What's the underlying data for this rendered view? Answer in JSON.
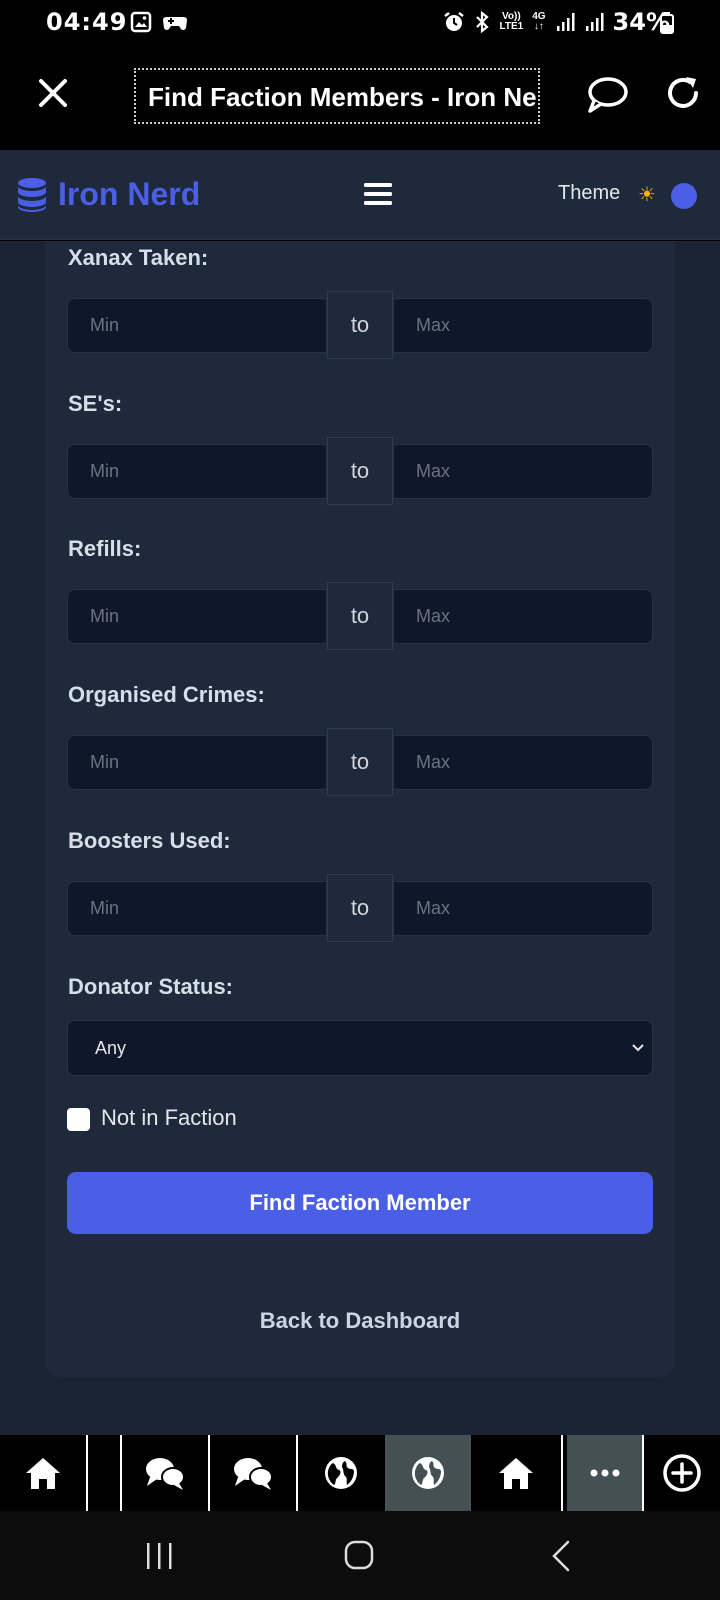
{
  "status_bar": {
    "time": "04:49",
    "network_top": "Vo))",
    "network_bottom": "LTE1",
    "network_type": "4G",
    "battery": "34%",
    "left_icons": [
      "image-icon",
      "game-controller-icon"
    ],
    "right_icons": [
      "alarm-icon",
      "bluetooth-icon",
      "signal-icon",
      "signal-icon",
      "battery-icon"
    ]
  },
  "browser": {
    "title": "Find Faction Members - Iron Nerd",
    "close_icon": "close-icon",
    "chat_icon": "chat-bubble-icon",
    "refresh_icon": "refresh-icon"
  },
  "header": {
    "brand": "Iron Nerd",
    "brand_icon": "database-icon",
    "menu_icon": "hamburger-icon",
    "theme_label": "Theme",
    "theme_icon": "sun-icon",
    "accent_color": "#4b5fe6"
  },
  "form": {
    "range_separator": "to",
    "min_placeholder": "Min",
    "max_placeholder": "Max",
    "fields": [
      {
        "label": "Xanax Taken:"
      },
      {
        "label": "SE's:"
      },
      {
        "label": "Refills:"
      },
      {
        "label": "Organised Crimes:"
      },
      {
        "label": "Boosters Used:"
      }
    ],
    "donator_status": {
      "label": "Donator Status:",
      "selected": "Any"
    },
    "not_in_faction": {
      "label": "Not in Faction",
      "checked": false
    },
    "submit_label": "Find Faction Member",
    "back_link": "Back to Dashboard"
  },
  "tab_bar": {
    "tabs": [
      {
        "icon": "home-icon",
        "active": false
      },
      {
        "icon": "chat-bubbles-icon",
        "active": false
      },
      {
        "icon": "chat-bubbles-icon",
        "active": false
      },
      {
        "icon": "globe-icon",
        "active": false
      },
      {
        "icon": "globe-icon",
        "active": true
      },
      {
        "icon": "home-icon",
        "active": false
      },
      {
        "icon": "more-icon",
        "active": true
      },
      {
        "icon": "add-tab-icon",
        "active": false
      }
    ]
  },
  "system_nav": {
    "buttons": [
      "recent-apps-icon",
      "home-circle-icon",
      "back-icon"
    ]
  }
}
